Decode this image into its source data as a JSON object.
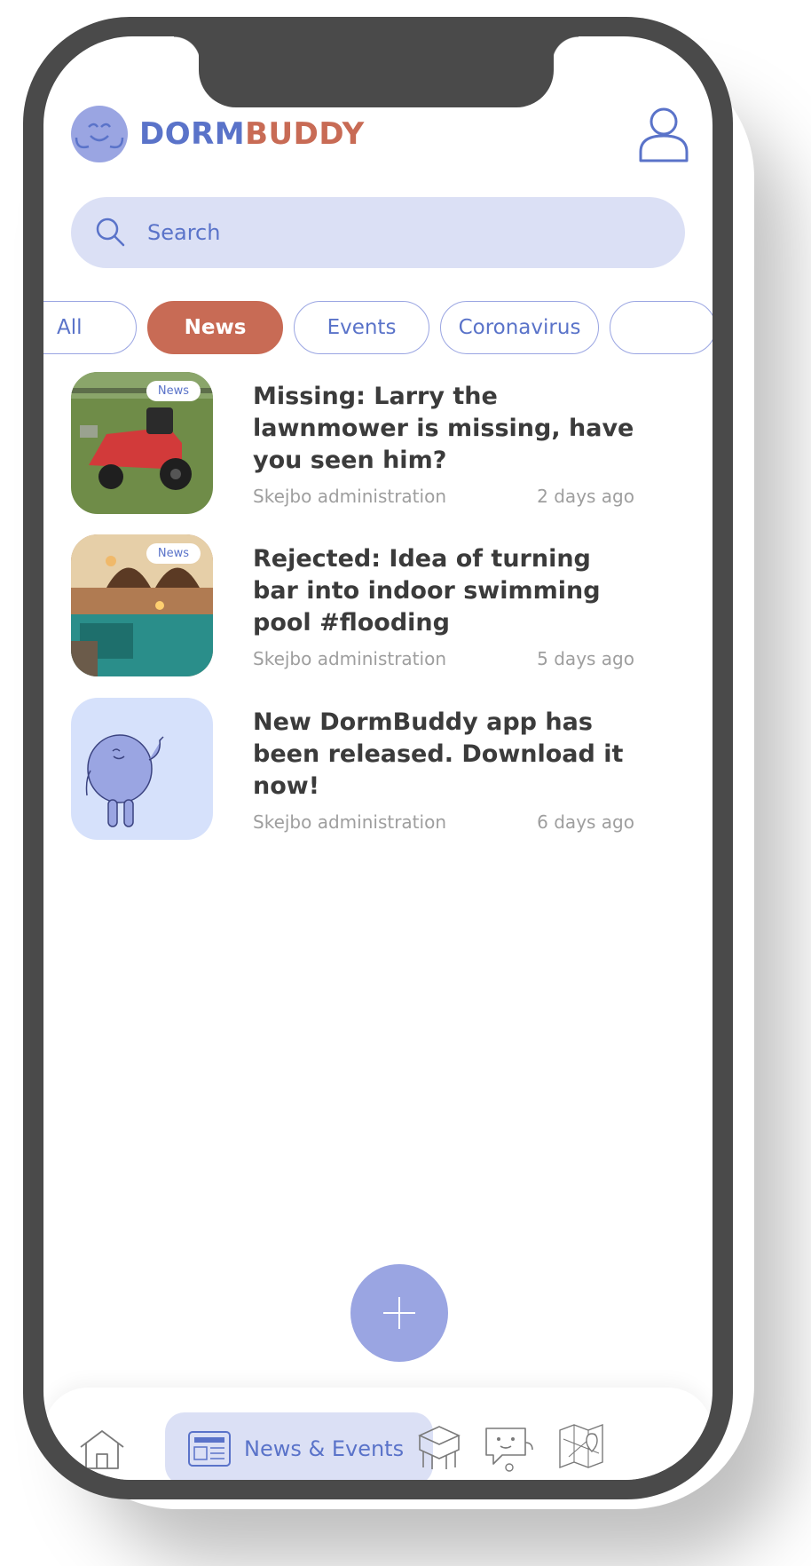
{
  "app": {
    "name_part1": "DORM",
    "name_part2": "BUDDY"
  },
  "search": {
    "placeholder": "Search"
  },
  "chips": [
    {
      "label": "All",
      "active": false
    },
    {
      "label": "News",
      "active": true
    },
    {
      "label": "Events",
      "active": false
    },
    {
      "label": "Coronavirus",
      "active": false
    }
  ],
  "news": [
    {
      "badge": "News",
      "title": "Missing: Larry the lawnmower is missing, have you seen him?",
      "author": "Skejbo administration",
      "time": "2 days ago",
      "thumb": "lawnmower-photo"
    },
    {
      "badge": "News",
      "title": "Rejected: Idea of turning bar into indoor swimming pool #flooding",
      "author": "Skejbo administration",
      "time": "5 days ago",
      "thumb": "pool-photo"
    },
    {
      "badge": "",
      "title": "New DormBuddy app has been released. Download it now!",
      "author": "Skejbo administration",
      "time": "6 days ago",
      "thumb": "mascot-illustration"
    }
  ],
  "nav": {
    "active_label": "News & Events",
    "items": [
      "home-icon",
      "news-icon",
      "furniture-icon",
      "chat-icon",
      "map-icon"
    ]
  },
  "colors": {
    "primary": "#5a73c9",
    "accent": "#c86b55",
    "light": "#dbe0f5",
    "fab": "#9aa5e2"
  }
}
